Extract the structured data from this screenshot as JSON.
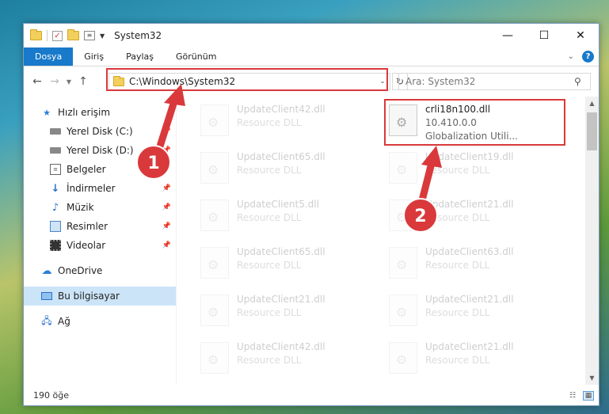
{
  "window": {
    "title": "System32",
    "controls": {
      "minimize": "—",
      "maximize": "☐",
      "close": "✕"
    }
  },
  "ribbon": {
    "tabs": [
      "Dosya",
      "Giriş",
      "Paylaş",
      "Görünüm"
    ],
    "active_tab": "Dosya",
    "accent_color": "#1979ca"
  },
  "address_bar": {
    "path": "C:\\Windows\\System32",
    "search_placeholder": "Ara: System32"
  },
  "nav_pane": {
    "quick_access": "Hızlı erişim",
    "items": [
      {
        "label": "Yerel Disk (C:)",
        "pinned": true
      },
      {
        "label": "Yerel Disk (D:)",
        "pinned": true
      },
      {
        "label": "Belgeler",
        "pinned": true
      },
      {
        "label": "İndirmeler",
        "pinned": true
      },
      {
        "label": "Müzik",
        "pinned": true
      },
      {
        "label": "Resimler",
        "pinned": true
      },
      {
        "label": "Videolar",
        "pinned": true
      }
    ],
    "onedrive": "OneDrive",
    "this_pc": "Bu bilgisayar",
    "network": "Ağ"
  },
  "files": {
    "highlighted": {
      "name": "crli18n100.dll",
      "version": "10.410.0.0",
      "description": "Globalization Utili..."
    },
    "left_column": [
      {
        "name": "UpdateClient42.dll",
        "type": "Resource DLL"
      },
      {
        "name": "UpdateClient65.dll",
        "type": "Resource DLL"
      },
      {
        "name": "UpdateClient5.dll",
        "type": "Resource DLL"
      },
      {
        "name": "UpdateClient65.dll",
        "type": "Resource DLL"
      },
      {
        "name": "UpdateClient21.dll",
        "type": "Resource DLL"
      },
      {
        "name": "UpdateClient42.dll",
        "type": "Resource DLL"
      }
    ],
    "right_column": [
      {
        "name": "UpdateClient19.dll",
        "type": "Resource DLL"
      },
      {
        "name": "UpdateClient21.dll",
        "type": "Resource DLL"
      },
      {
        "name": "UpdateClient63.dll",
        "type": "Resource DLL"
      },
      {
        "name": "UpdateClient21.dll",
        "type": "Resource DLL"
      },
      {
        "name": "UpdateClient21.dll",
        "type": "Resource DLL"
      }
    ]
  },
  "status_bar": {
    "item_count": "190 öğe"
  },
  "annotations": {
    "step1": "1",
    "step2": "2",
    "color": "#d9393b"
  }
}
